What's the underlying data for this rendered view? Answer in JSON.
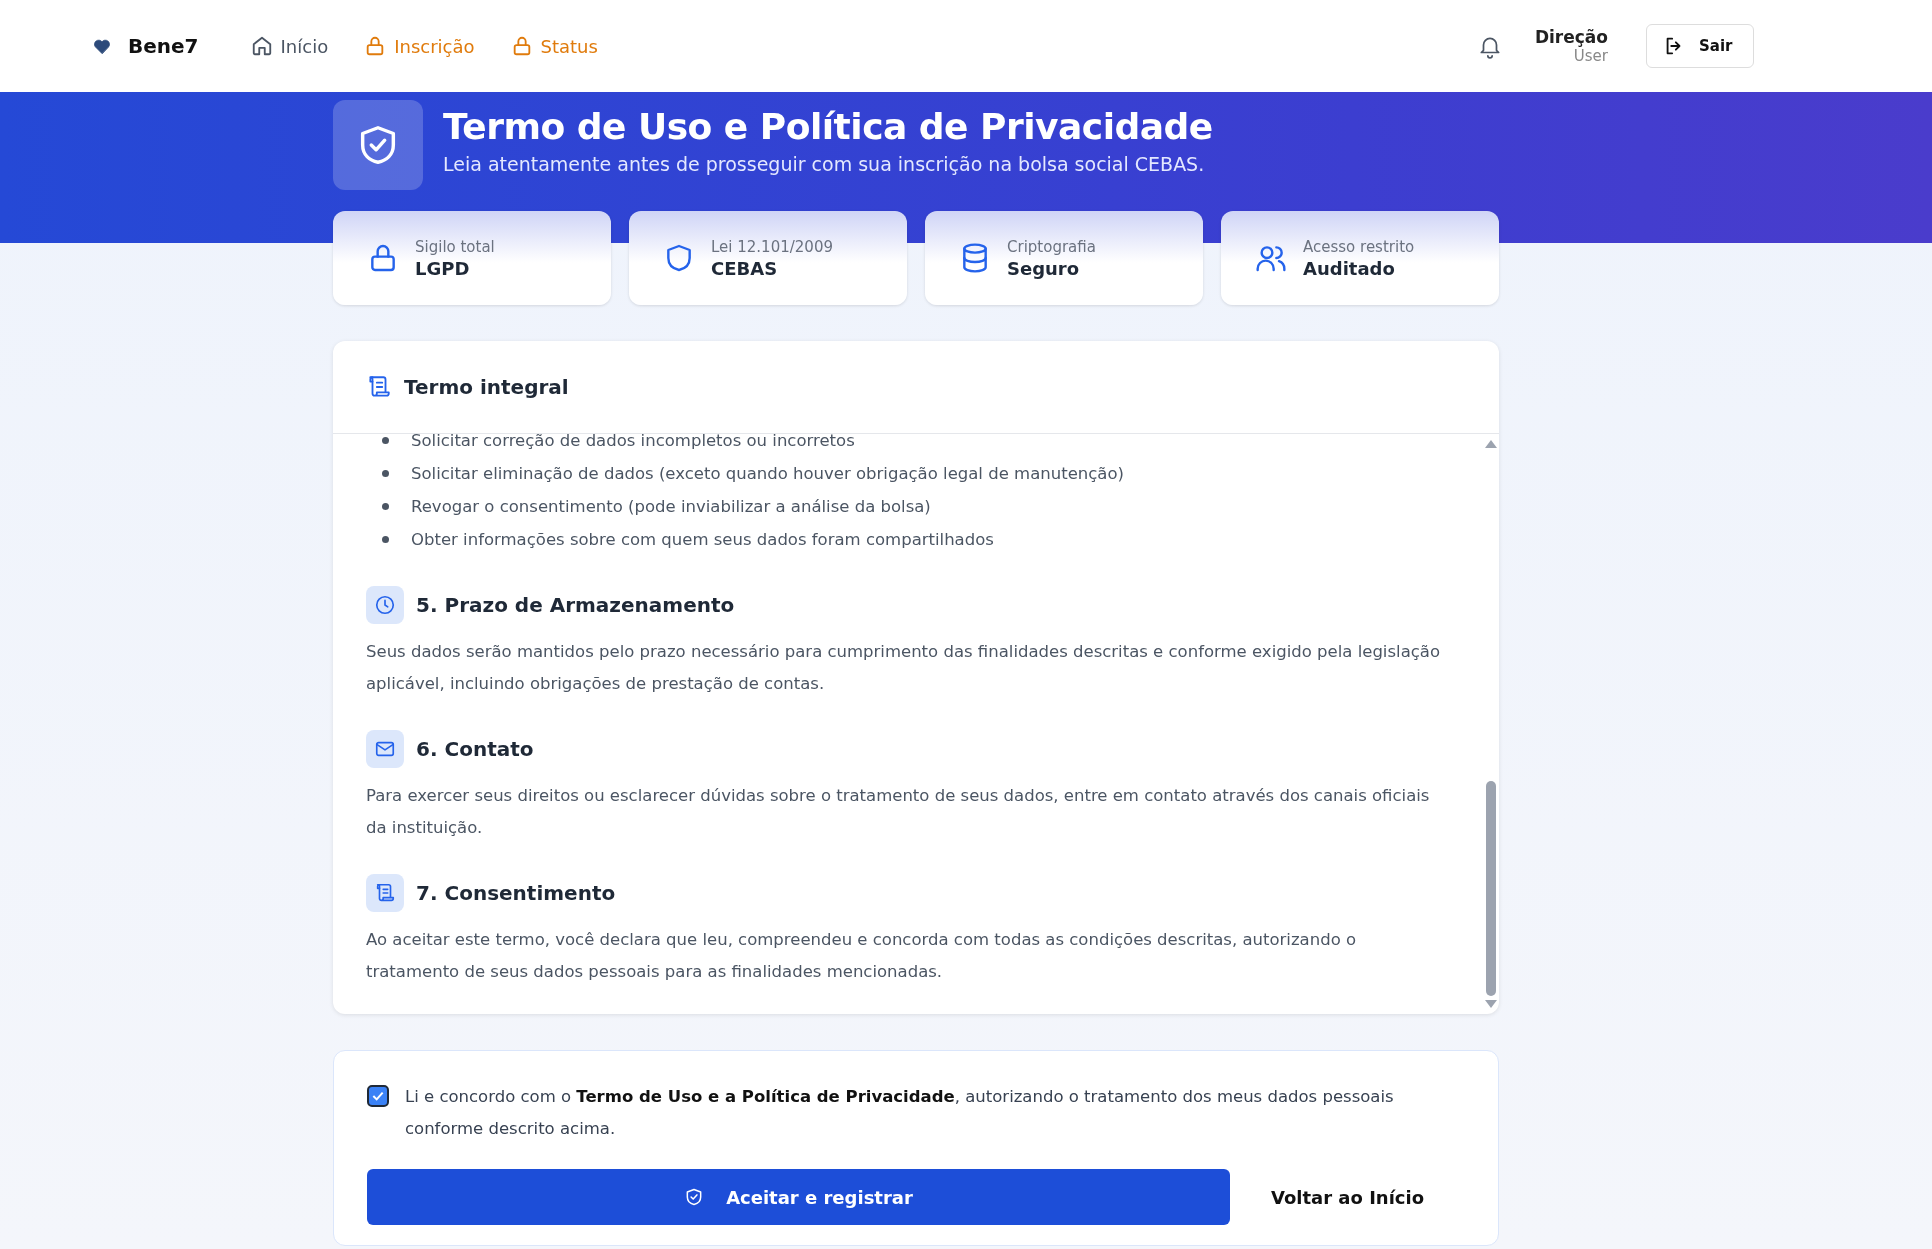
{
  "brand": "Bene7",
  "nav": [
    {
      "label": "Início",
      "locked": false
    },
    {
      "label": "Inscrição",
      "locked": true
    },
    {
      "label": "Status",
      "locked": true
    }
  ],
  "user": {
    "name": "Direção",
    "role": "User"
  },
  "logout_button": "Sair",
  "banner": {
    "title": "Termo de Uso e Política de Privacidade",
    "subtitle": "Leia atentamente antes de prosseguir com sua inscrição na bolsa social CEBAS."
  },
  "stats": [
    {
      "label": "Sigilo total",
      "value": "LGPD"
    },
    {
      "label": "Lei 12.101/2009",
      "value": "CEBAS"
    },
    {
      "label": "Criptografia",
      "value": "Seguro"
    },
    {
      "label": "Acesso restrito",
      "value": "Auditado"
    }
  ],
  "terms": {
    "title": "Termo integral",
    "bullets": [
      "Solicitar correção de dados incompletos ou incorretos",
      "Solicitar eliminação de dados (exceto quando houver obrigação legal de manutenção)",
      "Revogar o consentimento (pode inviabilizar a análise da bolsa)",
      "Obter informações sobre com quem seus dados foram compartilhados"
    ],
    "sections": [
      {
        "title": "5. Prazo de Armazenamento",
        "text": "Seus dados serão mantidos pelo prazo necessário para cumprimento das finalidades descritas e conforme exigido pela legislação aplicável, incluindo obrigações de prestação de contas."
      },
      {
        "title": "6. Contato",
        "text": "Para exercer seus direitos ou esclarecer dúvidas sobre o tratamento de seus dados, entre em contato através dos canais oficiais da instituição."
      },
      {
        "title": "7. Consentimento",
        "text": "Ao aceitar este termo, você declara que leu, compreendeu e concorda com todas as condições descritas, autorizando o tratamento de seus dados pessoais para as finalidades mencionadas."
      }
    ]
  },
  "consent": {
    "checked": true,
    "text": "Li e concordo com o **Termo de Uso e a Política de Privacidade**, autorizando o tratamento dos meus dados pessoais conforme descrito acima."
  },
  "accept_button": "Aceitar e registrar",
  "back_button": "Voltar ao Início"
}
